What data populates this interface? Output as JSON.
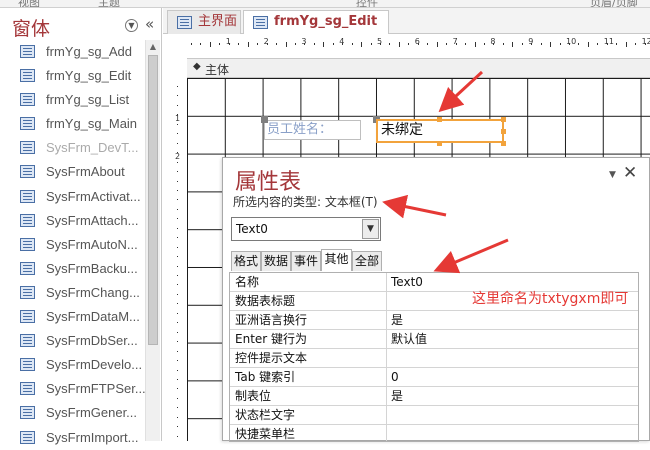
{
  "colors": {
    "accent": "#a4373a",
    "annotation": "#e53935",
    "selection": "#f2a33c",
    "form_icon": "#4a6fa5"
  },
  "ribbon": {
    "left_text": "视图",
    "mid_text": "主题",
    "right_text": "控件",
    "far_text": "页眉/页脚"
  },
  "nav": {
    "title": "窗体",
    "dropdown_icon": "chevron-down-icon",
    "collapse_glyph": "«",
    "items": [
      {
        "label": "frmYg_sg_Add"
      },
      {
        "label": "frmYg_sg_Edit"
      },
      {
        "label": "frmYg_sg_List"
      },
      {
        "label": "frmYg_sg_Main"
      },
      {
        "label": "SysFrm_DevT..."
      },
      {
        "label": "SysFrmAbout"
      },
      {
        "label": "SysFrmActivat..."
      },
      {
        "label": "SysFrmAttach..."
      },
      {
        "label": "SysFrmAutoN..."
      },
      {
        "label": "SysFrmBacku..."
      },
      {
        "label": "SysFrmChang..."
      },
      {
        "label": "SysFrmDataM..."
      },
      {
        "label": "SysFrmDbSer..."
      },
      {
        "label": "SysFrmDevelo..."
      },
      {
        "label": "SysFrmFTPSer..."
      },
      {
        "label": "SysFrmGener..."
      },
      {
        "label": "SysFrmImport..."
      }
    ]
  },
  "tabs": [
    {
      "label": "主界面"
    },
    {
      "label": "frmYg_sg_Edit"
    }
  ],
  "design": {
    "ruler_numbers": [
      "1",
      "2",
      "3",
      "4",
      "5",
      "6",
      "7",
      "8",
      "9",
      "10",
      "11",
      "12"
    ],
    "vruler_numbers": [
      "1",
      "2"
    ],
    "section_marker": "◆",
    "section_label": "主体",
    "label_text": "员工姓名：",
    "textbox_text": "未绑定"
  },
  "property_sheet": {
    "title": "属性表",
    "type_label": "所选内容的类型: 文本框(T)",
    "selected_control": "Text0",
    "menu_glyph": "▼",
    "close_glyph": "✕",
    "tabs": [
      {
        "label": "格式"
      },
      {
        "label": "数据"
      },
      {
        "label": "事件"
      },
      {
        "label": "其他"
      },
      {
        "label": "全部"
      }
    ],
    "active_tab": "其他",
    "rows": [
      {
        "name": "名称",
        "value": "Text0"
      },
      {
        "name": "数据表标题",
        "value": ""
      },
      {
        "name": "亚洲语言换行",
        "value": "是"
      },
      {
        "name": "Enter 键行为",
        "value": "默认值"
      },
      {
        "name": "控件提示文本",
        "value": ""
      },
      {
        "name": "Tab 键索引",
        "value": "0"
      },
      {
        "name": "制表位",
        "value": "是"
      },
      {
        "name": "状态栏文字",
        "value": ""
      },
      {
        "name": "快捷菜单栏",
        "value": ""
      }
    ]
  },
  "annotation": {
    "text": "这里命名为txtygxm即可"
  }
}
